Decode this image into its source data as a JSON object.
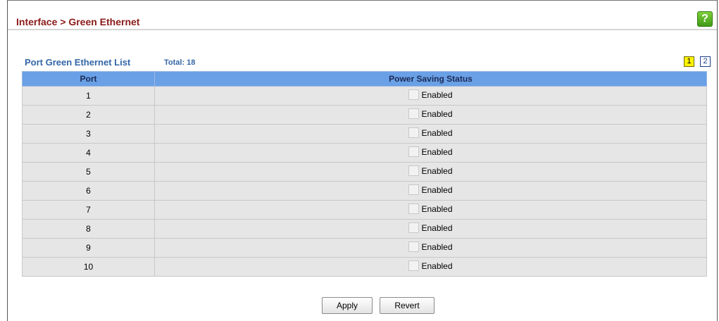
{
  "header": {
    "title": "Interface > Green Ethernet",
    "help_icon": "help-icon"
  },
  "list": {
    "title": "Port Green Ethernet List",
    "total": "Total: 18",
    "pages": [
      "1",
      "2"
    ],
    "current_page": "1"
  },
  "table": {
    "columns": [
      "Port",
      "Power Saving Status"
    ],
    "rows": [
      {
        "port": "1",
        "status_label": "Enabled",
        "checked": false
      },
      {
        "port": "2",
        "status_label": "Enabled",
        "checked": false
      },
      {
        "port": "3",
        "status_label": "Enabled",
        "checked": false
      },
      {
        "port": "4",
        "status_label": "Enabled",
        "checked": false
      },
      {
        "port": "5",
        "status_label": "Enabled",
        "checked": false
      },
      {
        "port": "6",
        "status_label": "Enabled",
        "checked": false
      },
      {
        "port": "7",
        "status_label": "Enabled",
        "checked": false
      },
      {
        "port": "8",
        "status_label": "Enabled",
        "checked": false
      },
      {
        "port": "9",
        "status_label": "Enabled",
        "checked": false
      },
      {
        "port": "10",
        "status_label": "Enabled",
        "checked": false
      }
    ]
  },
  "actions": {
    "apply_label": "Apply",
    "revert_label": "Revert"
  },
  "colors": {
    "title": "#8b1a1a",
    "list_header": "#3366a6",
    "table_header_bg": "#6aa0e6",
    "row_bg": "#e6e6e6",
    "active_page_bg": "#fff200"
  }
}
